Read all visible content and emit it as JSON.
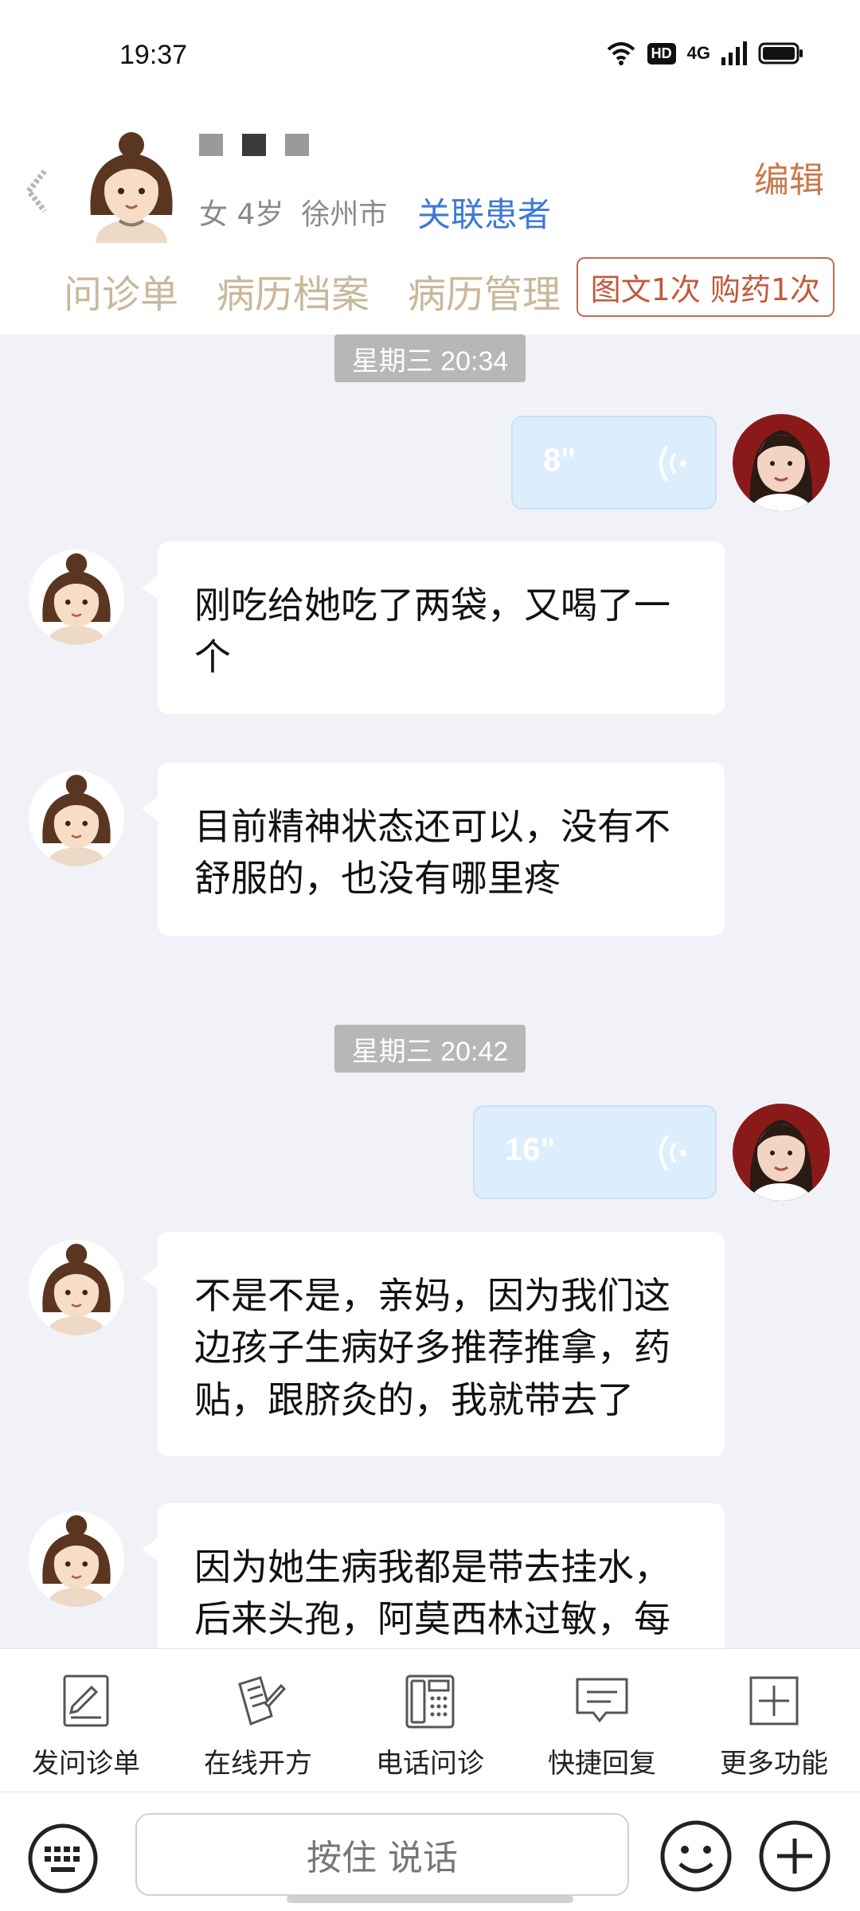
{
  "status_bar": {
    "time": "19:37",
    "hd": "HD",
    "network": "4G"
  },
  "header": {
    "patient_info": [
      "女 4岁",
      "徐州市"
    ],
    "link_patient": "关联患者",
    "edit": "编辑",
    "tabs": [
      "问诊单",
      "病历档案",
      "病历管理"
    ],
    "order_badge": "图文1次 购药1次"
  },
  "chat": [
    {
      "type": "timestamp",
      "text": "星期三 20:34"
    },
    {
      "type": "voice",
      "sender": "doctor",
      "duration": "8\""
    },
    {
      "type": "text",
      "sender": "patient",
      "text": "刚吃给她吃了两袋，又喝了一个"
    },
    {
      "type": "text",
      "sender": "patient",
      "text": "目前精神状态还可以，没有不舒服的，也没有哪里疼"
    },
    {
      "type": "timestamp",
      "text": "星期三 20:42"
    },
    {
      "type": "voice",
      "sender": "doctor",
      "duration": "16\""
    },
    {
      "type": "text",
      "sender": "patient",
      "text": "不是不是，亲妈，因为我们这边孩子生病好多推荐推拿，药贴，跟脐灸的，我就带去了"
    },
    {
      "type": "text",
      "sender": "patient",
      "text": "因为她生病我都是带去挂水，后来头孢，阿莫西林过敏，每"
    }
  ],
  "toolbar": [
    {
      "label": "发问诊单",
      "icon": "form-edit-icon"
    },
    {
      "label": "在线开方",
      "icon": "prescription-icon"
    },
    {
      "label": "电话问诊",
      "icon": "phone-icon"
    },
    {
      "label": "快捷回复",
      "icon": "quick-reply-icon"
    },
    {
      "label": "更多功能",
      "icon": "more-plus-icon"
    }
  ],
  "input": {
    "talk_label": "按住 说话"
  },
  "colors": {
    "accent": "#3c7ad6",
    "edit": "#c87a4e",
    "tab": "#c9b89a",
    "badge": "#c25a3c",
    "voice_bubble": "#dcedfc",
    "chat_bg": "#f1f2f7"
  }
}
